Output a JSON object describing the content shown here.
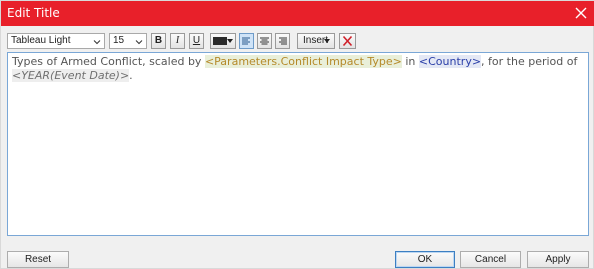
{
  "window": {
    "title": "Edit Title"
  },
  "toolbar": {
    "font_family": "Tableau Light",
    "font_size": "15",
    "bold_label": "B",
    "italic_label": "I",
    "underline_label": "U",
    "text_color": "#2b2b2b",
    "insert_label": "Insert"
  },
  "editor": {
    "text_before_param": "Types of Armed Conflict, scaled by ",
    "param_field": "<Parameters.Conflict Impact Type>",
    "text_in": " in ",
    "country_field": "<Country>",
    "text_period": ", for the period of ",
    "year_field": "<YEAR(Event Date)>",
    "text_end": "."
  },
  "buttons": {
    "reset": "Reset",
    "ok": "OK",
    "cancel": "Cancel",
    "apply": "Apply"
  }
}
